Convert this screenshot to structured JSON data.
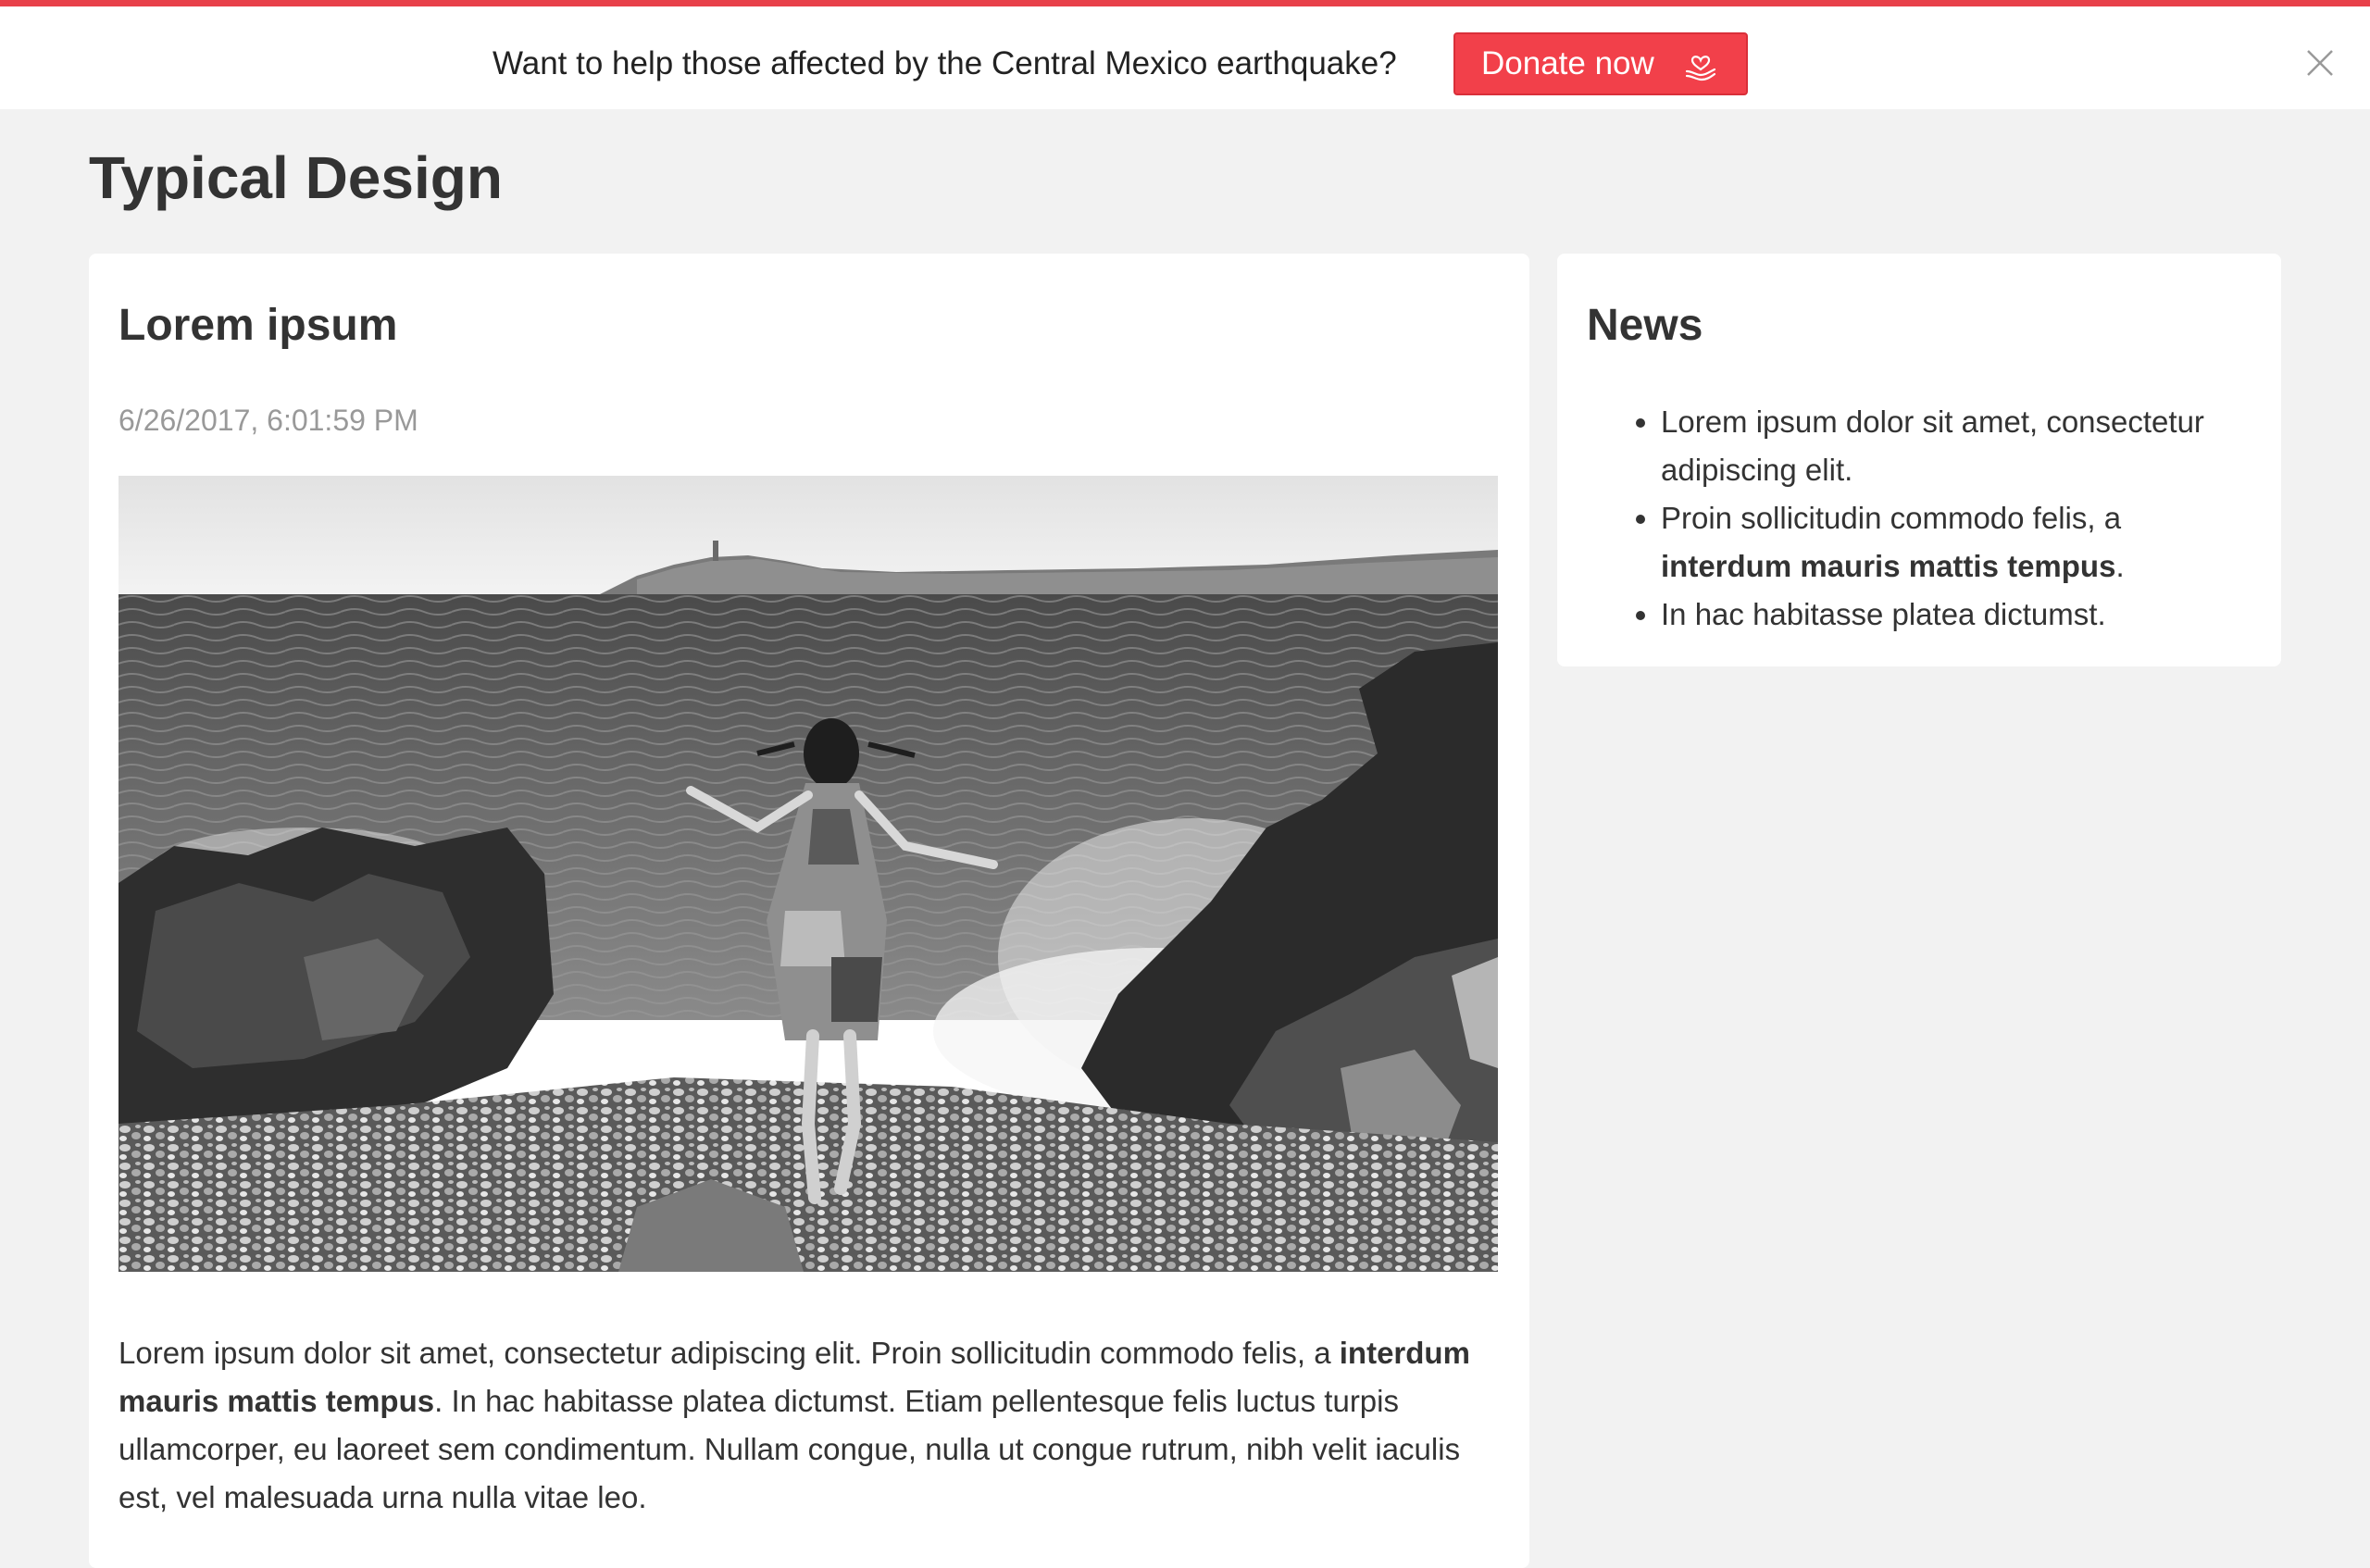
{
  "banner": {
    "message": "Want to help those affected by the Central Mexico earthquake?",
    "donate_label": "Donate now",
    "donate_icon": "heart-hand-icon",
    "close_icon": "close-icon",
    "accent_color": "#f2404a"
  },
  "page": {
    "title": "Typical Design"
  },
  "article": {
    "title": "Lorem ipsum",
    "date": "6/26/2017, 6:01:59 PM",
    "body": {
      "part1": "Lorem ipsum dolor sit amet, consectetur adipiscing elit. Proin sollicitudin commodo felis, a ",
      "bold": "interdum mauris mattis tempus",
      "part2": ". In hac habitasse platea dictumst. Etiam pellentesque felis luctus turpis ullamcorper, eu laoreet sem condimentum. Nullam congue, nulla ut congue rutrum, nibh velit iaculis est, vel malesuada urna nulla vitae leo."
    }
  },
  "news": {
    "title": "News",
    "items": [
      {
        "text": "Lorem ipsum dolor sit amet, consectetur adipiscing elit.",
        "bold": "",
        "after": ""
      },
      {
        "text": "Proin sollicitudin commodo felis, a ",
        "bold": "interdum mauris mattis tempus",
        "after": "."
      },
      {
        "text": "In hac habitasse platea dictumst.",
        "bold": "",
        "after": ""
      }
    ]
  }
}
